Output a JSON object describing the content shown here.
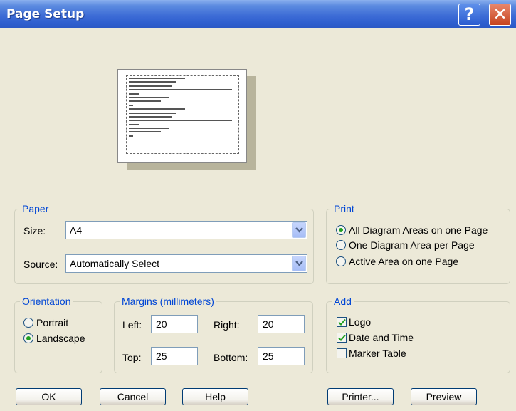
{
  "window": {
    "title": "Page Setup",
    "help_glyph": "?",
    "close_glyph": "✕"
  },
  "paper": {
    "group_label": "Paper",
    "size_label": "Size:",
    "size_value": "A4",
    "source_label": "Source:",
    "source_value": "Automatically Select"
  },
  "print": {
    "group_label": "Print",
    "options": [
      "All Diagram Areas on one Page",
      "One Diagram Area per Page",
      "Active Area on one Page"
    ],
    "selected": 0
  },
  "orientation": {
    "group_label": "Orientation",
    "options": [
      "Portrait",
      "Landscape"
    ],
    "selected": 1
  },
  "margins": {
    "group_label": "Margins (millimeters)",
    "left_label": "Left:",
    "left_value": "20",
    "right_label": "Right:",
    "right_value": "20",
    "top_label": "Top:",
    "top_value": "25",
    "bottom_label": "Bottom:",
    "bottom_value": "25"
  },
  "add": {
    "group_label": "Add",
    "items": [
      {
        "label": "Logo",
        "checked": true
      },
      {
        "label": "Date and Time",
        "checked": true
      },
      {
        "label": "Marker Table",
        "checked": false
      }
    ]
  },
  "buttons": {
    "ok": "OK",
    "cancel": "Cancel",
    "help": "Help",
    "printer": "Printer...",
    "preview": "Preview"
  },
  "colors": {
    "accent": "#0046D5",
    "titlebar": "#2F5FCF",
    "radio_dot": "#21A121"
  }
}
